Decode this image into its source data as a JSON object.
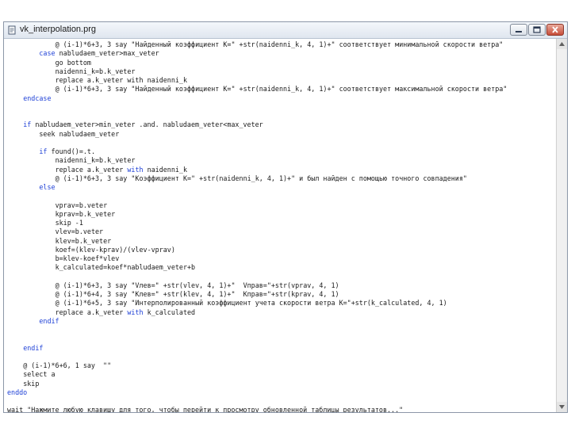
{
  "window": {
    "title": "vk_interpolation.prg"
  },
  "code_lines": [
    {
      "indent": 6,
      "segments": [
        {
          "t": "@ (i-1)*6+3, 3 say \"Найденный коэффициент K=\" +str(naidenni_k, 4, 1)+\" соответствует минимальной скорости ветра\""
        }
      ]
    },
    {
      "indent": 4,
      "segments": [
        {
          "t": "case",
          "k": true
        },
        {
          "t": " nabludaem_veter>max_veter"
        }
      ]
    },
    {
      "indent": 6,
      "segments": [
        {
          "t": "go bottom"
        }
      ]
    },
    {
      "indent": 6,
      "segments": [
        {
          "t": "naidenni_k=b.k_veter"
        }
      ]
    },
    {
      "indent": 6,
      "segments": [
        {
          "t": "replace a.k_veter with naidenni_k"
        }
      ]
    },
    {
      "indent": 6,
      "segments": [
        {
          "t": "@ (i-1)*6+3, 3 say \"Найденный коэффициент K=\" +str(naidenni_k, 4, 1)+\" соответствует максимальной скорости ветра\""
        }
      ]
    },
    {
      "indent": 2,
      "segments": [
        {
          "t": "endcase",
          "k": true
        }
      ]
    },
    {
      "indent": 0,
      "segments": [
        {
          "t": ""
        }
      ]
    },
    {
      "indent": 0,
      "segments": [
        {
          "t": ""
        }
      ]
    },
    {
      "indent": 2,
      "segments": [
        {
          "t": "if",
          "k": true
        },
        {
          "t": " nabludaem_veter>min_veter .and. nabludaem_veter<max_veter"
        }
      ]
    },
    {
      "indent": 4,
      "segments": [
        {
          "t": "seek nabludaem_veter"
        }
      ]
    },
    {
      "indent": 0,
      "segments": [
        {
          "t": ""
        }
      ]
    },
    {
      "indent": 4,
      "segments": [
        {
          "t": "if",
          "k": true
        },
        {
          "t": " found()=.t."
        }
      ]
    },
    {
      "indent": 6,
      "segments": [
        {
          "t": "naidenni_k=b.k_veter"
        }
      ]
    },
    {
      "indent": 6,
      "segments": [
        {
          "t": "replace a.k_veter "
        },
        {
          "t": "with",
          "k": true
        },
        {
          "t": " naidenni_k"
        }
      ]
    },
    {
      "indent": 6,
      "segments": [
        {
          "t": "@ (i-1)*6+3, 3 say \"Коэффициент K=\" +str(naidenni_k, 4, 1)+\" и был найден с помощью точного совпадения\""
        }
      ]
    },
    {
      "indent": 4,
      "segments": [
        {
          "t": "else",
          "k": true
        }
      ]
    },
    {
      "indent": 0,
      "segments": [
        {
          "t": ""
        }
      ]
    },
    {
      "indent": 6,
      "segments": [
        {
          "t": "vprav=b.veter"
        }
      ]
    },
    {
      "indent": 6,
      "segments": [
        {
          "t": "kprav=b.k_veter"
        }
      ]
    },
    {
      "indent": 6,
      "segments": [
        {
          "t": "skip -1"
        }
      ]
    },
    {
      "indent": 6,
      "segments": [
        {
          "t": "vlev=b.veter"
        }
      ]
    },
    {
      "indent": 6,
      "segments": [
        {
          "t": "klev=b.k_veter"
        }
      ]
    },
    {
      "indent": 6,
      "segments": [
        {
          "t": "koef=(klev-kprav)/(vlev-vprav)"
        }
      ]
    },
    {
      "indent": 6,
      "segments": [
        {
          "t": "b=klev-koef*vlev"
        }
      ]
    },
    {
      "indent": 6,
      "segments": [
        {
          "t": "k_calculated=koef*nabludaem_veter+b"
        }
      ]
    },
    {
      "indent": 0,
      "segments": [
        {
          "t": ""
        }
      ]
    },
    {
      "indent": 6,
      "segments": [
        {
          "t": "@ (i-1)*6+3, 3 say \"Vлев=\" +str(vlev, 4, 1)+\"  Vправ=\"+str(vprav, 4, 1)"
        }
      ]
    },
    {
      "indent": 6,
      "segments": [
        {
          "t": "@ (i-1)*6+4, 3 say \"Kлев=\" +str(klev, 4, 1)+\"  Kправ=\"+str(kprav, 4, 1)"
        }
      ]
    },
    {
      "indent": 6,
      "segments": [
        {
          "t": "@ (i-1)*6+5, 3 say \"Интерполированный коэффициент учета скорости ветра K=\"+str(k_calculated, 4, 1)"
        }
      ]
    },
    {
      "indent": 6,
      "segments": [
        {
          "t": "replace a.k_veter "
        },
        {
          "t": "with",
          "k": true
        },
        {
          "t": " k_calculated"
        }
      ]
    },
    {
      "indent": 4,
      "segments": [
        {
          "t": "endif",
          "k": true
        }
      ]
    },
    {
      "indent": 0,
      "segments": [
        {
          "t": ""
        }
      ]
    },
    {
      "indent": 0,
      "segments": [
        {
          "t": ""
        }
      ]
    },
    {
      "indent": 2,
      "segments": [
        {
          "t": "endif",
          "k": true
        }
      ]
    },
    {
      "indent": 0,
      "segments": [
        {
          "t": ""
        }
      ]
    },
    {
      "indent": 2,
      "segments": [
        {
          "t": "@ (i-1)*6+6, 1 say  \"\""
        }
      ]
    },
    {
      "indent": 2,
      "segments": [
        {
          "t": "select a"
        }
      ]
    },
    {
      "indent": 2,
      "segments": [
        {
          "t": "skip"
        }
      ]
    },
    {
      "indent": 0,
      "segments": [
        {
          "t": "enddo",
          "k": true
        }
      ]
    },
    {
      "indent": 0,
      "segments": [
        {
          "t": ""
        }
      ]
    },
    {
      "indent": 0,
      "segments": [
        {
          "t": "wait \"Нажмите любую клавишу для того, чтобы перейти к просмотру обновленной таблицы результатов...\""
        }
      ]
    }
  ],
  "colors": {
    "keyword": "#1d3fd6",
    "text": "#1a1a1a",
    "window_border": "#8c97a8"
  },
  "icons": {
    "title": "document-icon",
    "minimize": "minimize-icon",
    "maximize": "maximize-icon",
    "close": "close-icon"
  }
}
